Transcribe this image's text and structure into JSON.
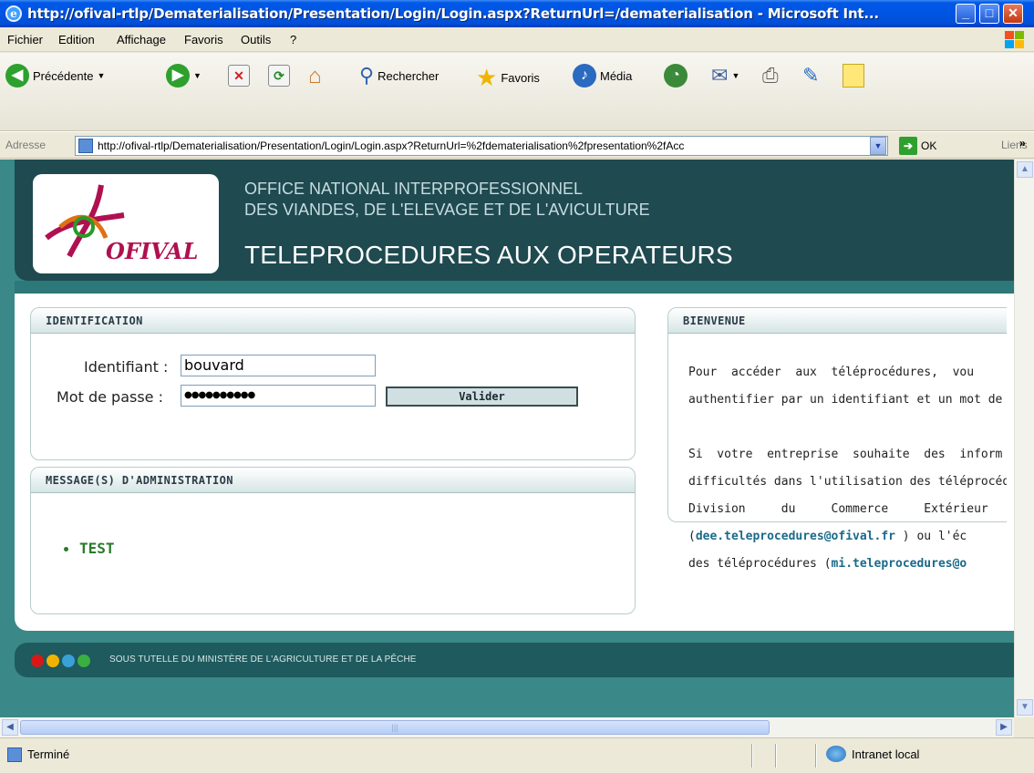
{
  "window": {
    "title": "http://ofival-rtlp/Dematerialisation/Presentation/Login/Login.aspx?ReturnUrl=/dematerialisation - Microsoft Int...",
    "min_icon": "minimize-icon",
    "max_icon": "maximize-icon",
    "close_icon": "close-icon"
  },
  "menu": {
    "items": [
      "Fichier",
      "Edition",
      "Affichage",
      "Favoris",
      "Outils",
      "?"
    ]
  },
  "toolbar": {
    "back_label": "Précédente",
    "search_label": "Rechercher",
    "favorites_label": "Favoris",
    "media_label": "Média"
  },
  "address": {
    "label": "Adresse",
    "url": "http://ofival-rtlp/Dematerialisation/Presentation/Login/Login.aspx?ReturnUrl=%2fdematerialisation%2fpresentation%2fAcc",
    "go_label": "OK",
    "links_label": "Liens"
  },
  "page": {
    "logo_text": "OFIVAL",
    "org_line1": "OFFICE NATIONAL INTERPROFESSIONNEL",
    "org_line2": "DES VIANDES, DE L'ELEVAGE ET DE L'AVICULTURE",
    "title": "TELEPROCEDURES AUX OPERATEURS",
    "identification": {
      "header": "IDENTIFICATION",
      "id_label": "Identifiant :",
      "id_value": "bouvard",
      "pwd_label": "Mot de passe :",
      "pwd_value": "●●●●●●●●●●",
      "submit_label": "Valider"
    },
    "messages": {
      "header": "MESSAGE(S) D'ADMINISTRATION",
      "items": [
        "TEST"
      ]
    },
    "welcome": {
      "header": "BIENVENUE",
      "p1_l1": "Pour  accéder  aux  téléprocédures,  vou",
      "p1_l2": "authentifier par un identifiant et un mot de p",
      "p2_l1": "Si  votre  entreprise  souhaite  des  inform",
      "p2_l2": "difficultés dans l'utilisation des téléprocédu",
      "p2_l3": "Division     du     Commerce     Extérieur",
      "p2_l4_open": "(",
      "p2_l4_email": "dee.teleprocedures@ofival.fr",
      "p2_l4_close": " ) ou l'éc",
      "p2_l5_text": "des téléprocédures (",
      "p2_l5_email": "mi.teleprocedures@o"
    },
    "footer_text": "SOUS TUTELLE DU MINISTÈRE DE L'AGRICULTURE ET DE LA PÊCHE"
  },
  "status": {
    "text": "Terminé",
    "zone": "Intranet local"
  },
  "colors": {
    "header_bg": "#1e4a50",
    "accent_teal": "#3a8888",
    "logo_red": "#b01050",
    "message_green": "#2a7a2a",
    "link_blue": "#1a6a8a"
  }
}
